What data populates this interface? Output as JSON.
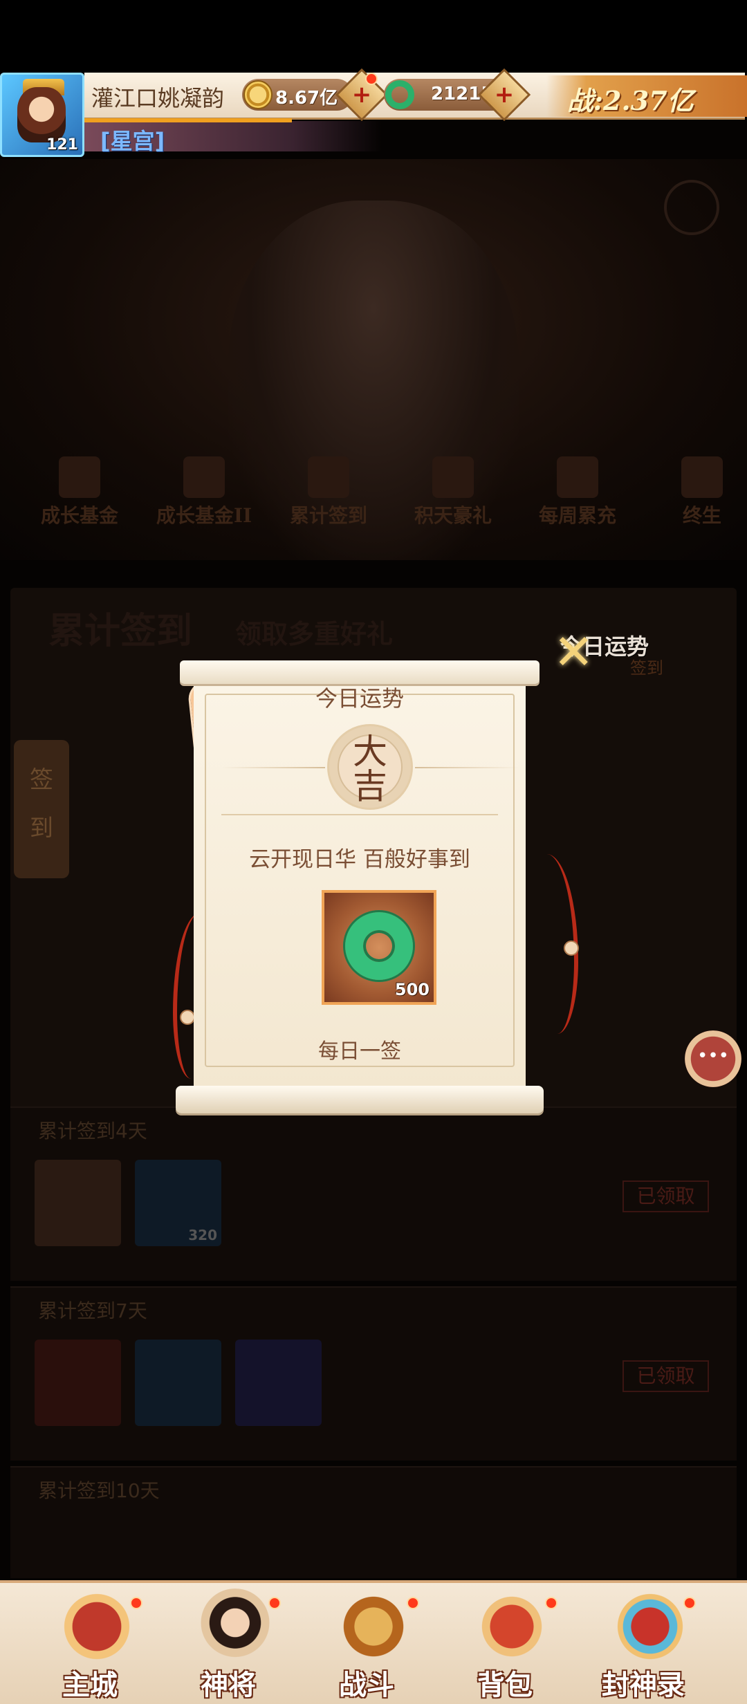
{
  "player": {
    "name": "灌江口姚凝韵",
    "level": "121",
    "title": "[星宫]"
  },
  "resources": {
    "gold": "8.67亿",
    "jade": "21215",
    "power": "战:2.37亿"
  },
  "tabs": [
    "成长基金",
    "成长基金II",
    "累计签到",
    "积天豪礼",
    "每周累充",
    "终生"
  ],
  "panel": {
    "heading": "累计签到",
    "subheading": "领取多重好礼",
    "side_tag": [
      "签",
      "到"
    ],
    "small_tag": "签到",
    "fortune_side": "今日运势"
  },
  "reward_rows": [
    {
      "title": "累计签到4天",
      "status": "已领取",
      "item_count": "320"
    },
    {
      "title": "累计签到7天",
      "status": "已领取"
    },
    {
      "title": "累计签到10天"
    }
  ],
  "popup": {
    "title": "今日运势",
    "fortune": [
      "大",
      "吉"
    ],
    "blessing": "云开现日华  百般好事到",
    "reward_qty": "500",
    "footer": "每日一签"
  },
  "bottom_nav": [
    {
      "label": "主城",
      "icon": "castle-icon"
    },
    {
      "label": "神将",
      "icon": "hero-icon"
    },
    {
      "label": "战斗",
      "icon": "crossed-swords-icon"
    },
    {
      "label": "背包",
      "icon": "bag-icon"
    },
    {
      "label": "封神录",
      "icon": "scroll-record-icon"
    }
  ],
  "colors": {
    "accent_gold": "#f4d27a",
    "jade_green": "#36c07c",
    "scroll_paper": "#fbf4e6",
    "text_brown": "#7a4e34",
    "badge_red": "#ff3a1a"
  }
}
